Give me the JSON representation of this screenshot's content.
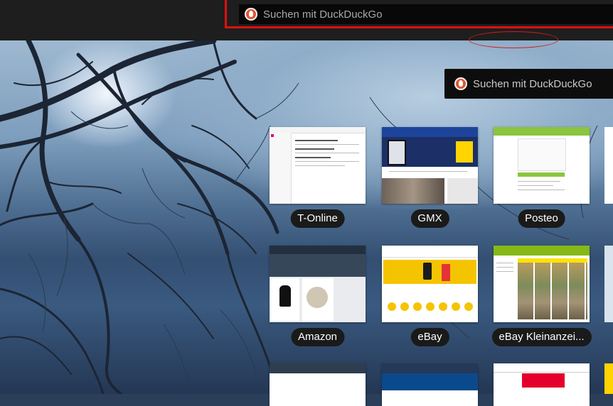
{
  "top_search": {
    "placeholder": "Suchen mit DuckDuckGo",
    "highlight_color": "#e01010"
  },
  "main_search": {
    "placeholder": "Suchen mit DuckDuckGo"
  },
  "tiles": [
    {
      "label": "T-Online"
    },
    {
      "label": "GMX"
    },
    {
      "label": "Posteo"
    },
    {
      "label": "Amazon"
    },
    {
      "label": "eBay"
    },
    {
      "label": "eBay Kleinanzei..."
    }
  ],
  "colors": {
    "topbar": "#1e1e1e",
    "tile_label_bg": "#1a1a1a",
    "annotation": "#d21c1c"
  },
  "icons": {
    "search_engine_logo": "duckduckgo-icon"
  }
}
